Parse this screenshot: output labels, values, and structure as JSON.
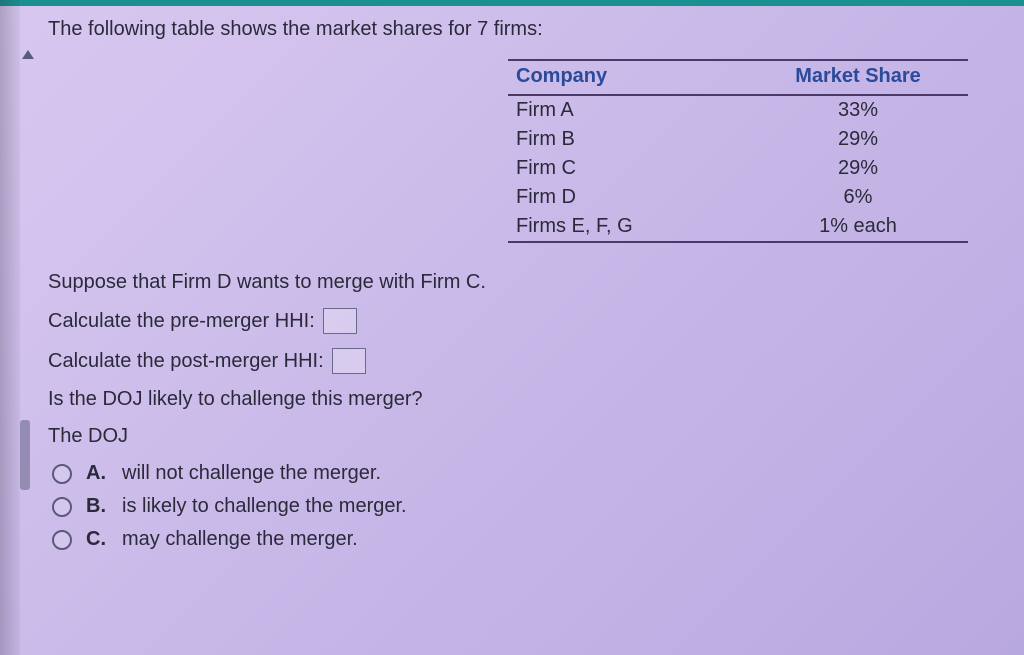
{
  "intro": "The following table shows the market shares for 7 firms:",
  "table": {
    "headers": {
      "company": "Company",
      "share": "Market Share"
    },
    "rows": [
      {
        "company": "Firm A",
        "share": "33%"
      },
      {
        "company": "Firm B",
        "share": "29%"
      },
      {
        "company": "Firm C",
        "share": "29%"
      },
      {
        "company": "Firm D",
        "share": "6%"
      },
      {
        "company": "Firms E, F, G",
        "share": "1% each"
      }
    ]
  },
  "suppose": "Suppose that Firm D wants to merge with Firm C.",
  "pre_label": "Calculate the pre-merger HHI:",
  "post_label": "Calculate the post-merger HHI:",
  "q3": "Is the DOJ likely to challenge this merger?",
  "stem": "The DOJ",
  "options": {
    "a": {
      "letter": "A.",
      "text": "will not challenge the merger."
    },
    "b": {
      "letter": "B.",
      "text": "is likely to challenge the merger."
    },
    "c": {
      "letter": "C.",
      "text": "may challenge the merger."
    }
  },
  "chart_data": {
    "type": "table",
    "title": "Market shares for 7 firms",
    "columns": [
      "Company",
      "Market Share"
    ],
    "rows": [
      [
        "Firm A",
        "33%"
      ],
      [
        "Firm B",
        "29%"
      ],
      [
        "Firm C",
        "29%"
      ],
      [
        "Firm D",
        "6%"
      ],
      [
        "Firms E, F, G",
        "1% each"
      ]
    ]
  }
}
